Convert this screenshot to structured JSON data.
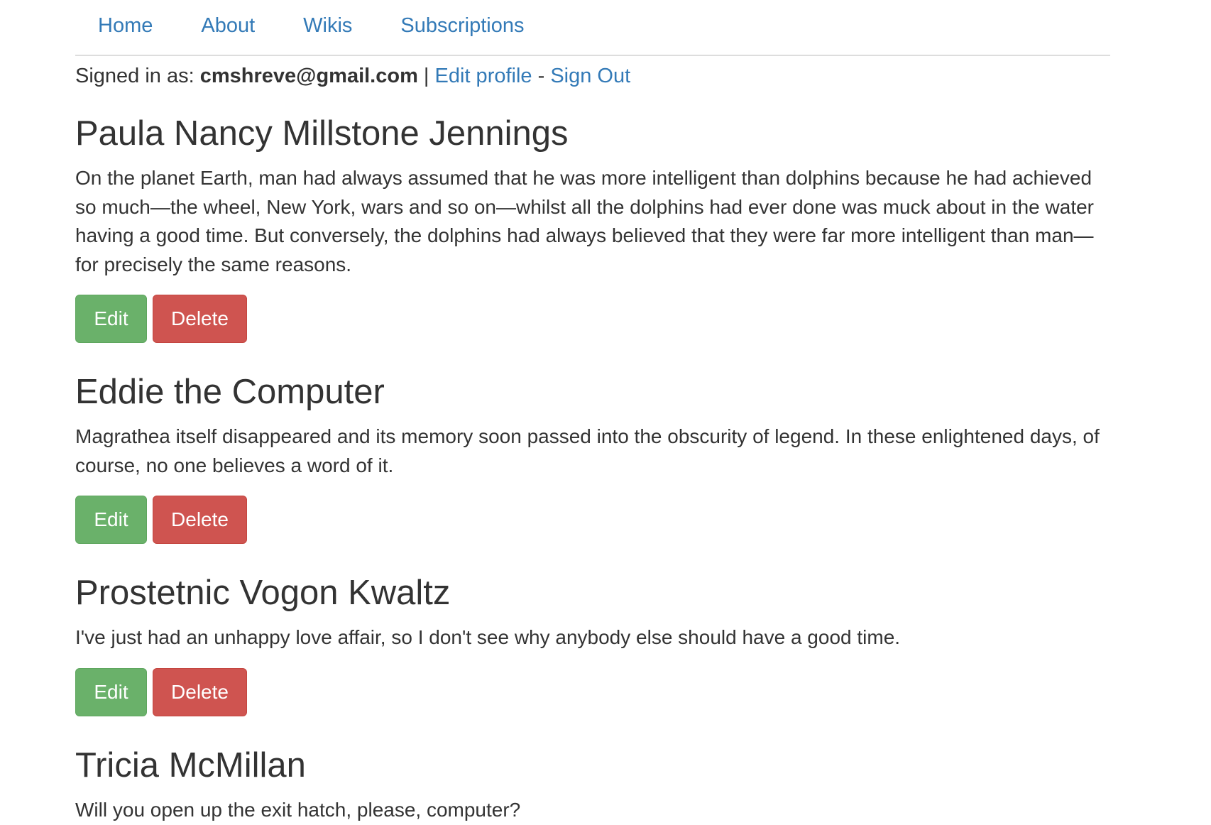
{
  "nav": {
    "items": [
      {
        "label": "Home"
      },
      {
        "label": "About"
      },
      {
        "label": "Wikis"
      },
      {
        "label": "Subscriptions"
      }
    ]
  },
  "session": {
    "prefix": "Signed in as: ",
    "email": "cmshreve@gmail.com",
    "separator": " | ",
    "edit_profile": "Edit profile",
    "dash": " - ",
    "sign_out": "Sign Out"
  },
  "entries": [
    {
      "title": "Paula Nancy Millstone Jennings",
      "body": "On the planet Earth, man had always assumed that he was more intelligent than dolphins because he had achieved so much—the wheel, New York, wars and so on—whilst all the dolphins had ever done was muck about in the water having a good time. But conversely, the dolphins had always believed that they were far more intelligent than man—for precisely the same reasons.",
      "edit_label": "Edit",
      "delete_label": "Delete"
    },
    {
      "title": "Eddie the Computer",
      "body": "Magrathea itself disappeared and its memory soon passed into the obscurity of legend. In these enlightened days, of course, no one believes a word of it.",
      "edit_label": "Edit",
      "delete_label": "Delete"
    },
    {
      "title": "Prostetnic Vogon Kwaltz",
      "body": "I've just had an unhappy love affair, so I don't see why anybody else should have a good time.",
      "edit_label": "Edit",
      "delete_label": "Delete"
    },
    {
      "title": "Tricia McMillan",
      "body": "Will you open up the exit hatch, please, computer?"
    }
  ],
  "colors": {
    "link": "#337ab7",
    "edit_button": "#6ab16a",
    "delete_button": "#cf5450"
  }
}
